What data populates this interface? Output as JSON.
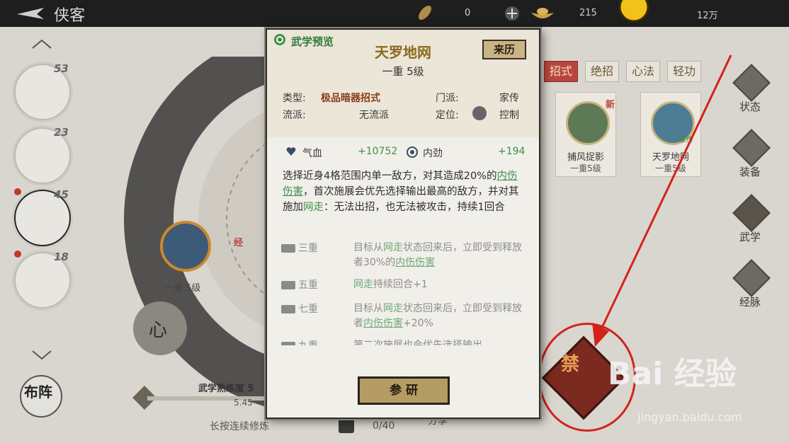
{
  "topbar": {
    "title": "侠客",
    "resources": [
      {
        "icon": "leaf-icon",
        "value": "0"
      },
      {
        "icon": "ingot-icon",
        "value": "215"
      },
      {
        "icon": "coin-icon",
        "value": "12万"
      }
    ]
  },
  "characters": [
    {
      "level": "53",
      "has_dot": false
    },
    {
      "level": "23",
      "has_dot": false
    },
    {
      "level": "45",
      "has_dot": true
    },
    {
      "level": "18",
      "has_dot": true
    }
  ],
  "wheel": {
    "skill_level": "一重 5级",
    "tier_badge": "经",
    "mind_label": "心"
  },
  "tabs": [
    {
      "label": "招式",
      "active": true
    },
    {
      "label": "绝招",
      "active": false
    },
    {
      "label": "心法",
      "active": false
    },
    {
      "label": "轻功",
      "active": false
    }
  ],
  "cards": [
    {
      "name": "捕风捉影",
      "level": "一重5级",
      "badge": "新"
    },
    {
      "name": "天罗地网",
      "level": "一重5级",
      "badge": "家传"
    }
  ],
  "right_nav": [
    "状态",
    "装备",
    "武学",
    "经脉"
  ],
  "popup": {
    "preview_label": "武学预览",
    "skill_name": "天罗地网",
    "skill_level": "一重 5级",
    "origin_button": "来历",
    "type_label": "类型:",
    "type_value": "极品暗器招式",
    "sect_label": "门派:",
    "sect_value": "家传",
    "school_label": "流派:",
    "school_value": "无流派",
    "role_label": "定位:",
    "role_value": "控制",
    "hp_label": "气血",
    "hp_value": "+10752",
    "inner_label": "内劲",
    "inner_value": "+194",
    "desc": {
      "p1": "选择近身4格范围内单一敌方，对其造成20%的",
      "k1": "内伤伤害",
      "p2": "，首次施展会优先选择输出最高的敌方，并对其施加",
      "k2": "网走",
      "p3": "：无法出招，也无法被攻击，持续1回合"
    },
    "tiers": [
      {
        "tier": "三重",
        "a": "目标从",
        "k1": "网走",
        "b": "状态回来后，立即受到释放者30%的",
        "k2": "内伤伤害",
        "c": ""
      },
      {
        "tier": "五重",
        "a": "",
        "k1": "网走",
        "b": "持续回合+1",
        "k2": "",
        "c": ""
      },
      {
        "tier": "七重",
        "a": "目标从",
        "k1": "网走",
        "b": "状态回来后，立即受到释放者",
        "k2": "内伤伤害",
        "c": "+20%"
      },
      {
        "tier": "九重",
        "a": "第二次施展也会优先选择输出",
        "k1": "",
        "b": "",
        "k2": "",
        "c": ""
      }
    ],
    "research_button": "参 研"
  },
  "bottom": {
    "proficiency_label": "武学熟练度 5",
    "proficiency_value": "5.45",
    "hold_hint": "长按连续修炼",
    "count": "0/40",
    "share_label": "分享",
    "formation_label": "布阵"
  },
  "forbidden_label": "禁",
  "watermark": {
    "brand": "Bai 经验",
    "url": "jingyan.baidu.com"
  },
  "colors": {
    "accent_red": "#b8463e",
    "highlight_green": "#3f8f4a",
    "annotation_red": "#d2231b"
  }
}
